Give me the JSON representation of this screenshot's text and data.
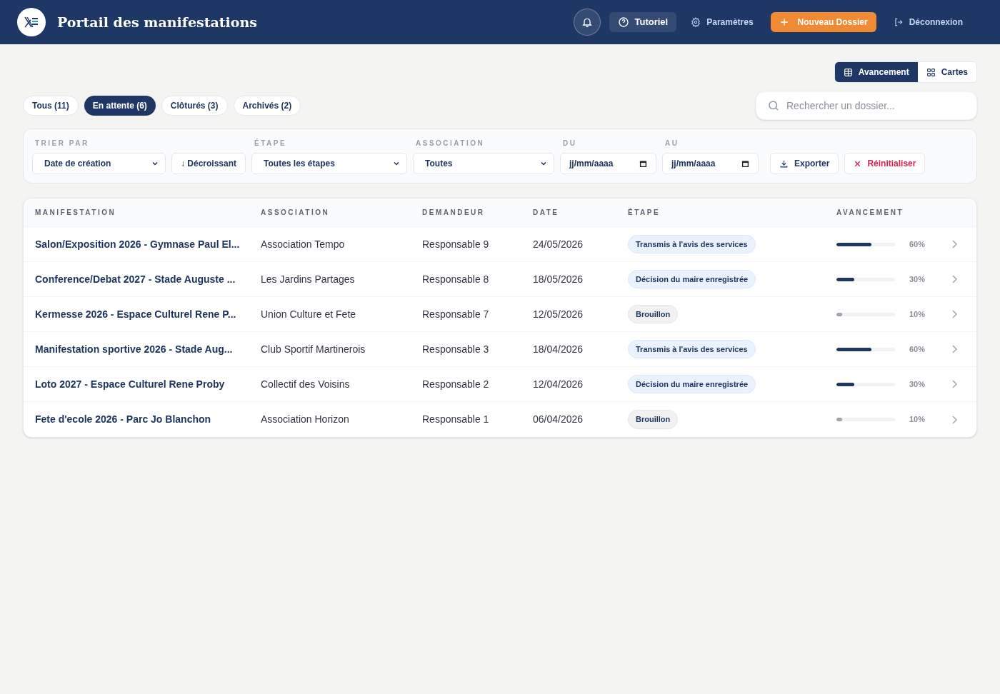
{
  "header": {
    "title": "Portail des manifestations",
    "actions": [
      {
        "kind": "bell"
      },
      {
        "kind": "tutorial",
        "label": "Tutoriel"
      },
      {
        "kind": "settings",
        "label": "Paramètres"
      },
      {
        "kind": "new",
        "label": "Nouveau Dossier"
      },
      {
        "kind": "logout",
        "label": "Déconnexion"
      }
    ]
  },
  "view_toggle": [
    {
      "kind": "table",
      "label": "Avancement",
      "selected": true
    },
    {
      "kind": "grid",
      "label": "Cartes",
      "selected": false
    }
  ],
  "tabs": [
    {
      "label": "Tous (11)",
      "selected": false
    },
    {
      "label": "En attente (6)",
      "selected": true
    },
    {
      "label": "Clôturés (3)",
      "selected": false
    },
    {
      "label": "Archivés (2)",
      "selected": false
    }
  ],
  "search": {
    "placeholder": "Rechercher un dossier..."
  },
  "filters": {
    "sort_label": "TRIER PAR",
    "sort_value": "Date de création",
    "order": "↓ Décroissant",
    "stage_label": "ÉTAPE",
    "stage_value": "Toutes les étapes",
    "association_label": "ASSOCIATION",
    "association_value": "Toutes",
    "from_label": "DU",
    "from_placeholder": "jj/mm/aaaa",
    "to_label": "AU",
    "to_placeholder": "jj/mm/aaaa",
    "export": "Exporter",
    "reset": "Réinitialiser"
  },
  "table": {
    "columns": [
      "MANIFESTATION",
      "ASSOCIATION",
      "DEMANDEUR",
      "DATE",
      "ÉTAPE",
      "AVANCEMENT"
    ],
    "rows": [
      {
        "name": "Salon/Exposition 2026 - Gymnase Paul El...",
        "association": "Association Tempo",
        "requester": "Responsable 9",
        "date": "24/05/2026",
        "stage": "Transmis à l'avis des services",
        "kind": "active",
        "level": 0.6,
        "percent": "60%"
      },
      {
        "name": "Conference/Debat 2027 - Stade Auguste ...",
        "association": "Les Jardins Partages",
        "requester": "Responsable 8",
        "date": "18/05/2026",
        "stage": "Décision du maire enregistrée",
        "kind": "active",
        "level": 0.3,
        "percent": "30%"
      },
      {
        "name": "Kermesse 2026 - Espace Culturel Rene P...",
        "association": "Union Culture et Fete",
        "requester": "Responsable 7",
        "date": "12/05/2026",
        "stage": "Brouillon",
        "kind": "draft",
        "level": 0.1,
        "percent": "10%"
      },
      {
        "name": "Manifestation sportive 2026 - Stade Aug...",
        "association": "Club Sportif Martinerois",
        "requester": "Responsable 3",
        "date": "18/04/2026",
        "stage": "Transmis à l'avis des services",
        "kind": "active",
        "level": 0.6,
        "percent": "60%"
      },
      {
        "name": "Loto 2027 - Espace Culturel Rene Proby",
        "association": "Collectif des Voisins",
        "requester": "Responsable 2",
        "date": "12/04/2026",
        "stage": "Décision du maire enregistrée",
        "kind": "active",
        "level": 0.3,
        "percent": "30%"
      },
      {
        "name": "Fete d'ecole 2026 - Parc Jo Blanchon",
        "association": "Association Horizon",
        "requester": "Responsable 1",
        "date": "06/04/2026",
        "stage": "Brouillon",
        "kind": "draft",
        "level": 0.1,
        "percent": "10%"
      }
    ]
  }
}
